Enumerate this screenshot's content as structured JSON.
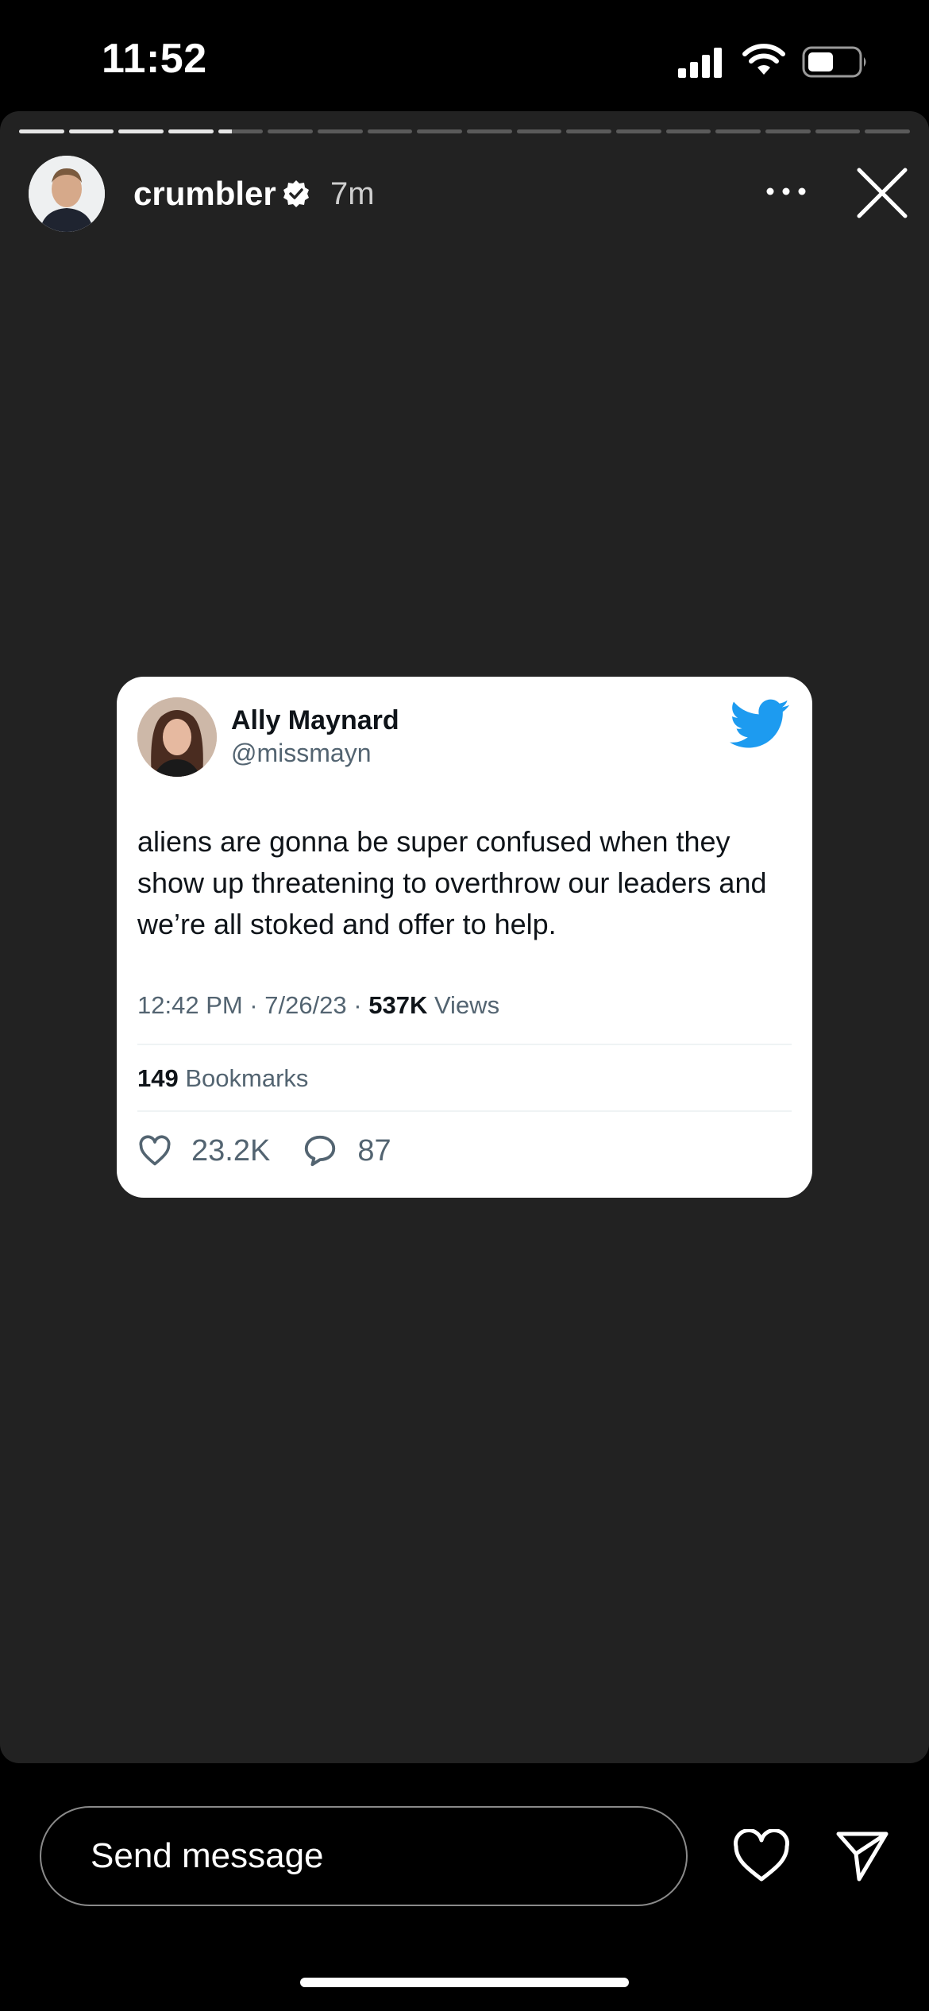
{
  "status_bar": {
    "time": "11:52",
    "icons": [
      "signal-icon",
      "wifi-icon",
      "battery-icon"
    ],
    "battery_level": 0.5
  },
  "story": {
    "background": "#222222",
    "progress": {
      "segments": 18,
      "completed": 4,
      "current_fraction": 0.3
    },
    "header": {
      "username": "crumbler",
      "verified": true,
      "time_ago": "7m"
    },
    "tweet": {
      "name": "Ally Maynard",
      "handle": "@missmayn",
      "text": "aliens are gonna be super confused when they show up threatening to overthrow our leaders and we’re all stoked and offer to help.",
      "timestamp": "12:42 PM · 7/26/23 · ",
      "views_count": "537K",
      "views_label": " Views",
      "bookmarks_count": "149",
      "bookmarks_label": " Bookmarks",
      "likes": "23.2K",
      "replies": "87",
      "brand_color": "#1d9bf0"
    }
  },
  "bottom_bar": {
    "message_placeholder": "Send message",
    "icons": [
      "heart-icon",
      "send-icon"
    ]
  }
}
